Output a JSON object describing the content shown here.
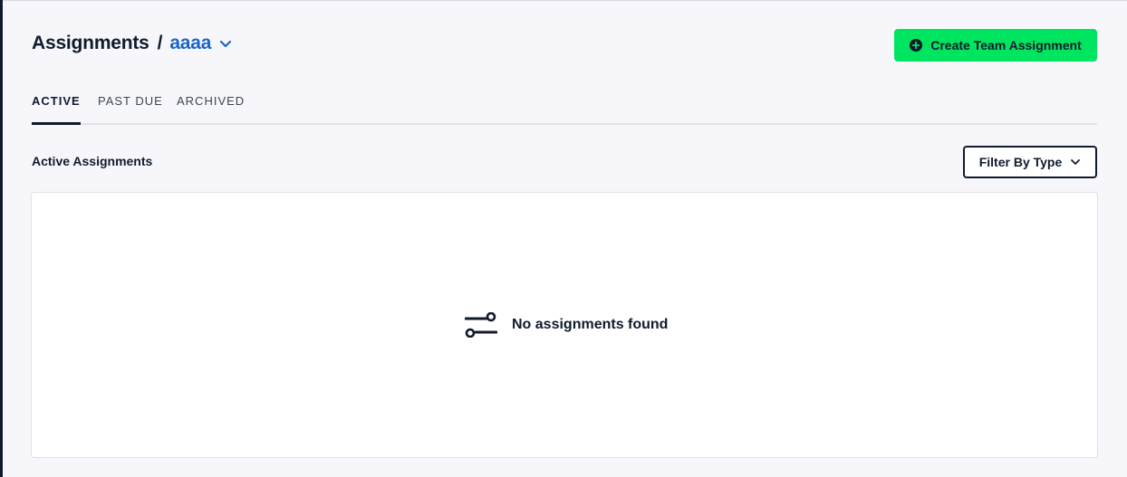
{
  "header": {
    "title": "Assignments",
    "separator": "/",
    "team_name": "aaaa",
    "team_chevron_icon": "chevron-down-icon"
  },
  "actions": {
    "create_label": "Create Team Assignment",
    "create_icon": "plus-circle-icon",
    "accent_color": "#00e55f"
  },
  "tabs": [
    {
      "label": "ACTIVE",
      "active": true
    },
    {
      "label": "PAST DUE",
      "active": false
    },
    {
      "label": "ARCHIVED",
      "active": false
    }
  ],
  "section": {
    "title": "Active Assignments",
    "filter_label": "Filter By Type",
    "filter_icon": "chevron-down-icon"
  },
  "empty_state": {
    "icon": "sliders-icon",
    "message": "No assignments found"
  },
  "colors": {
    "text": "#0f1b2d",
    "link": "#1a64c8",
    "background": "#f7f7fb"
  }
}
